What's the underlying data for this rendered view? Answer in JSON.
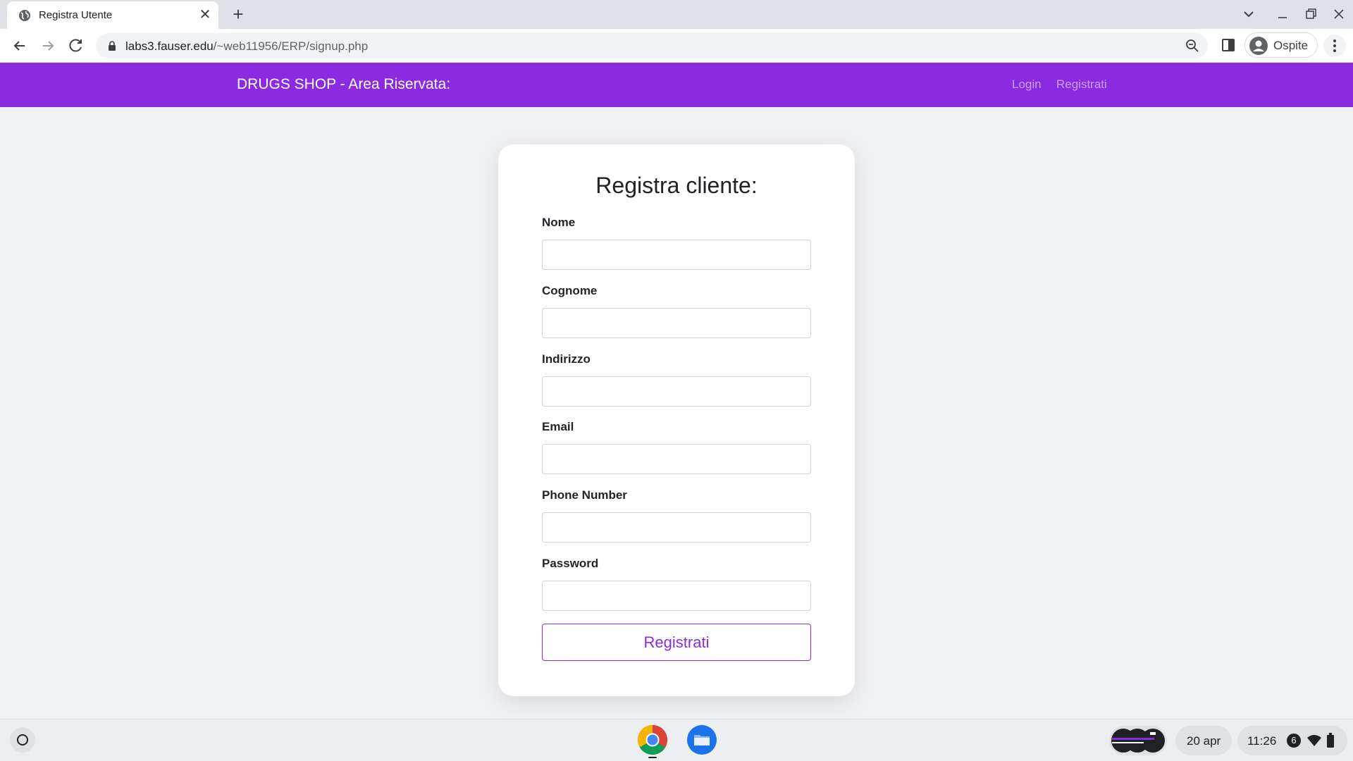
{
  "browser": {
    "tab_title": "Registra Utente",
    "tab_close": "✕",
    "new_tab": "+",
    "url_host": "labs3.fauser.edu",
    "url_path": "/~web11956/ERP/signup.php",
    "profile_label": "Ospite"
  },
  "navbar": {
    "brand": "DRUGS SHOP - Area Riservata:",
    "links": [
      {
        "label": "Login"
      },
      {
        "label": "Registrati"
      }
    ]
  },
  "form": {
    "title": "Registra cliente:",
    "fields": [
      {
        "label": "Nome",
        "value": "",
        "type": "text"
      },
      {
        "label": "Cognome",
        "value": "",
        "type": "text"
      },
      {
        "label": "Indirizzo",
        "value": "",
        "type": "text"
      },
      {
        "label": "Email",
        "value": "",
        "type": "email"
      },
      {
        "label": "Phone Number",
        "value": "",
        "type": "tel"
      },
      {
        "label": "Password",
        "value": "",
        "type": "password"
      }
    ],
    "submit_label": "Registrati"
  },
  "shelf": {
    "date": "20 apr",
    "time": "11:26",
    "notification_count": "6",
    "apps": [
      {
        "name": "Chrome",
        "icon": "chrome-icon"
      },
      {
        "name": "Files",
        "icon": "files-folder-icon"
      }
    ]
  },
  "colors": {
    "brand_purple": "#8a2be2",
    "page_bg": "#f0f1f5"
  }
}
